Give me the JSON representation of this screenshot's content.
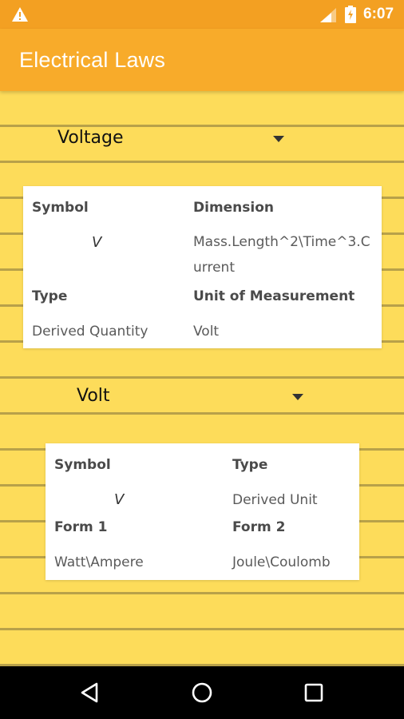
{
  "status_bar": {
    "time": "6:07",
    "icons": [
      "warning-icon",
      "signal-icon",
      "battery-charging-icon"
    ]
  },
  "app_bar": {
    "title": "Electrical Laws"
  },
  "quantity_spinner": {
    "selected": "Voltage"
  },
  "quantity_card": {
    "symbol_label": "Symbol",
    "symbol_value": "V",
    "dimension_label": "Dimension",
    "dimension_value": "Mass.Length^2\\Time^3.Current",
    "type_label": "Type",
    "type_value": "Derived Quantity",
    "unit_label": "Unit of Measurement",
    "unit_value": "Volt"
  },
  "unit_spinner": {
    "selected": "Volt"
  },
  "unit_card": {
    "symbol_label": "Symbol",
    "symbol_value": "V",
    "type_label": "Type",
    "type_value": "Derived Unit",
    "form1_label": "Form 1",
    "form1_value": "Watt\\Ampere",
    "form2_label": "Form 2",
    "form2_value": "Joule\\Coulomb"
  },
  "nav_bar": {
    "icons": [
      "back-icon",
      "home-icon",
      "recents-icon"
    ]
  },
  "colors": {
    "status_bar": "#f3a022",
    "app_bar": "#f8ab2a",
    "paper": "#fddc5a",
    "rule_line": "#b8a149",
    "card": "#ffffff"
  }
}
